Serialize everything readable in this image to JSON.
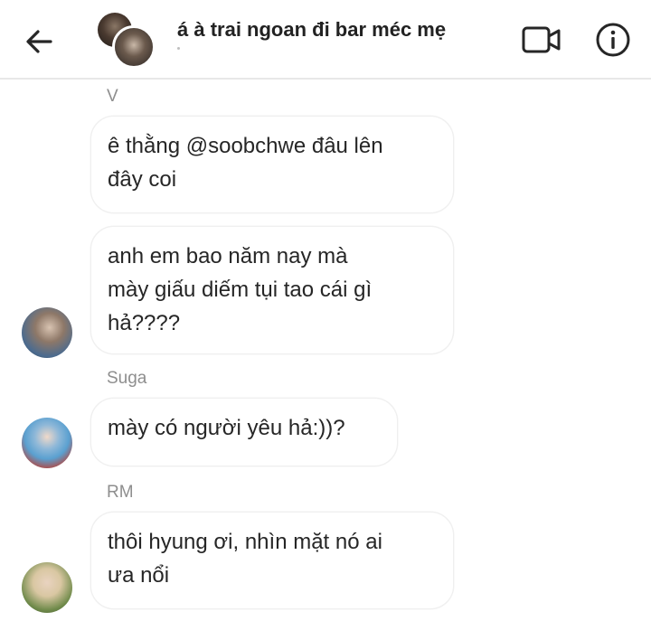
{
  "header": {
    "title": "á à trai ngoan đi bar méc mẹ",
    "back_icon": "arrow-left-icon",
    "video_icon": "video-camera-icon",
    "info_icon": "info-icon"
  },
  "messages": [
    {
      "sender": "V",
      "bubbles": [
        "ê thằng @soobchwe đâu lên\nđây coi",
        "anh em bao năm nay mà\nmày giấu diếm tụi tao cái gì\nhả????"
      ]
    },
    {
      "sender": "Suga",
      "bubbles": [
        "mày có người yêu hả:))?"
      ]
    },
    {
      "sender": "RM",
      "bubbles": [
        "thôi hyung ơi, nhìn mặt nó ai\nưa nổi"
      ]
    }
  ]
}
